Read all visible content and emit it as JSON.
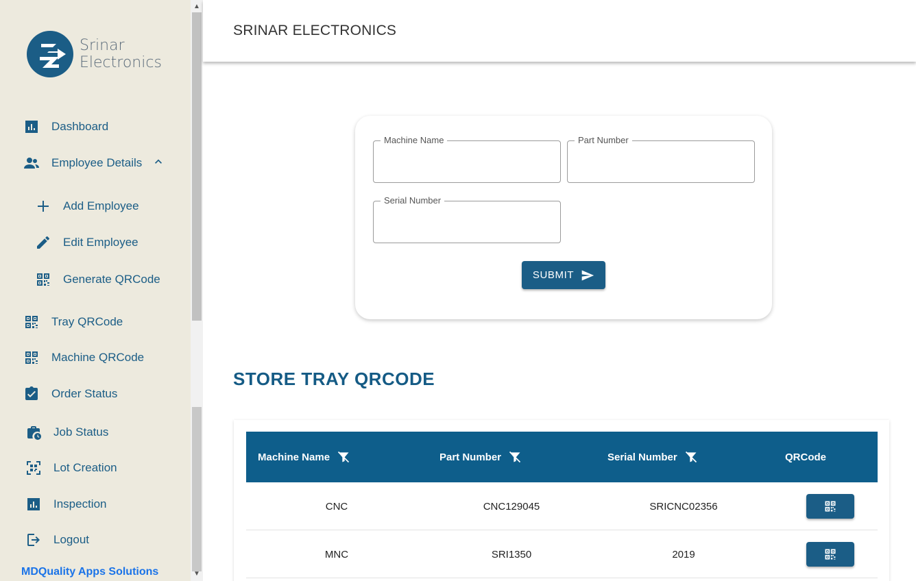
{
  "brand": {
    "line1": "Srinar",
    "line2": "Electronics"
  },
  "header": {
    "title": "SRINAR ELECTRONICS"
  },
  "sidebar": {
    "items": [
      {
        "label": "Dashboard",
        "icon": "bar-chart-icon"
      },
      {
        "label": "Employee Details",
        "icon": "people-icon"
      },
      {
        "label": "Add Employee",
        "icon": "plus-icon"
      },
      {
        "label": "Edit Employee",
        "icon": "pencil-icon"
      },
      {
        "label": "Generate QRCode",
        "icon": "qrcode-icon"
      },
      {
        "label": "Tray QRCode",
        "icon": "qrcode-icon"
      },
      {
        "label": "Machine QRCode",
        "icon": "qrcode-icon"
      },
      {
        "label": "Order Status",
        "icon": "clipboard-check-icon"
      },
      {
        "label": "Job Status",
        "icon": "briefcase-clock-icon"
      },
      {
        "label": "Lot Creation",
        "icon": "qr-scan-icon"
      },
      {
        "label": "Inspection",
        "icon": "bar-chart-icon"
      },
      {
        "label": "Logout",
        "icon": "logout-icon"
      }
    ],
    "footer": "MDQuality Apps Solutions"
  },
  "form": {
    "machine_name_label": "Machine Name",
    "machine_name_value": "",
    "part_number_label": "Part Number",
    "part_number_value": "",
    "serial_number_label": "Serial Number",
    "serial_number_value": "",
    "submit_label": "SUBMIT"
  },
  "section": {
    "title": "STORE TRAY QRCODE"
  },
  "table": {
    "headers": [
      "Machine Name",
      "Part Number",
      "Serial Number",
      "QRCode"
    ],
    "rows": [
      {
        "machine": "CNC",
        "part": "CNC129045",
        "serial": "SRICNC02356"
      },
      {
        "machine": "MNC",
        "part": "SRI1350",
        "serial": "2019"
      }
    ]
  },
  "colors": {
    "primary": "#1b5d86",
    "sidebar_bg": "#edeade",
    "table_header": "#0e5e8b",
    "footer_link": "#1a73e8"
  }
}
